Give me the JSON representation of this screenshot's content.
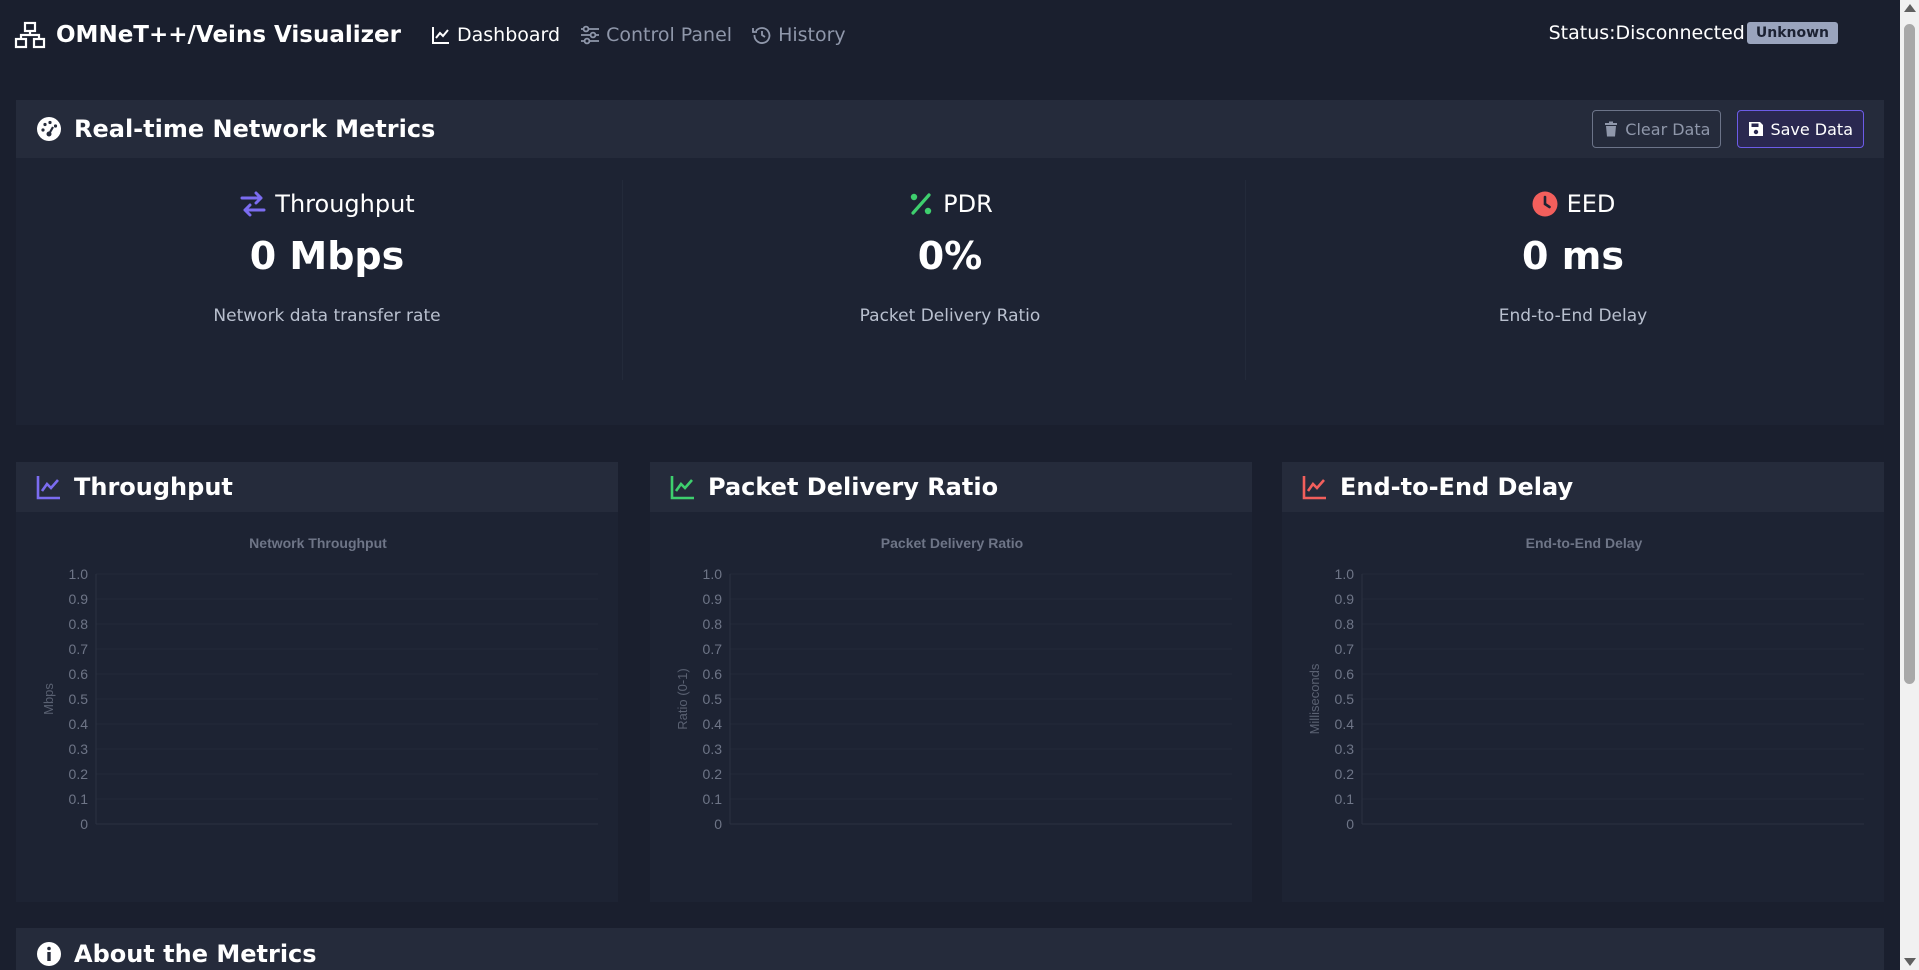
{
  "navbar": {
    "brand": "OMNeT++/Veins Visualizer",
    "links": [
      {
        "label": "Dashboard",
        "icon": "chart-line-icon",
        "active": true
      },
      {
        "label": "Control Panel",
        "icon": "sliders-icon",
        "active": false
      },
      {
        "label": "History",
        "icon": "history-icon",
        "active": false
      }
    ],
    "status_label": "Status:",
    "status_value": "Disconnected",
    "status_badge": "Unknown"
  },
  "metrics": {
    "title": "Real-time Network Metrics",
    "clear_label": "Clear Data",
    "save_label": "Save Data",
    "items": [
      {
        "title": "Throughput",
        "value": "0 Mbps",
        "desc": "Network data transfer rate",
        "icon": "exchange-icon",
        "color": "#7b6cf0"
      },
      {
        "title": "PDR",
        "value": "0%",
        "desc": "Packet Delivery Ratio",
        "icon": "percent-icon",
        "color": "#3ecf6e"
      },
      {
        "title": "EED",
        "value": "0 ms",
        "desc": "End-to-End Delay",
        "icon": "clock-icon",
        "color": "#f25f5c"
      }
    ]
  },
  "chart_data": [
    {
      "type": "line",
      "card_title": "Throughput",
      "title": "Network Throughput",
      "ylabel": "Mbps",
      "xlabel": "",
      "ylim": [
        0,
        1
      ],
      "yticks": [
        "1.0",
        "0.9",
        "0.8",
        "0.7",
        "0.6",
        "0.5",
        "0.4",
        "0.3",
        "0.2",
        "0.1",
        "0"
      ],
      "series": [],
      "color": "#7b6cf0"
    },
    {
      "type": "line",
      "card_title": "Packet Delivery Ratio",
      "title": "Packet Delivery Ratio",
      "ylabel": "Ratio (0-1)",
      "xlabel": "",
      "ylim": [
        0,
        1
      ],
      "yticks": [
        "1.0",
        "0.9",
        "0.8",
        "0.7",
        "0.6",
        "0.5",
        "0.4",
        "0.3",
        "0.2",
        "0.1",
        "0"
      ],
      "series": [],
      "color": "#3ecf6e"
    },
    {
      "type": "line",
      "card_title": "End-to-End Delay",
      "title": "End-to-End Delay",
      "ylabel": "Milliseconds",
      "xlabel": "",
      "ylim": [
        0,
        1
      ],
      "yticks": [
        "1.0",
        "0.9",
        "0.8",
        "0.7",
        "0.6",
        "0.5",
        "0.4",
        "0.3",
        "0.2",
        "0.1",
        "0"
      ],
      "series": [],
      "color": "#f25f5c"
    }
  ],
  "about": {
    "title": "About the Metrics"
  }
}
